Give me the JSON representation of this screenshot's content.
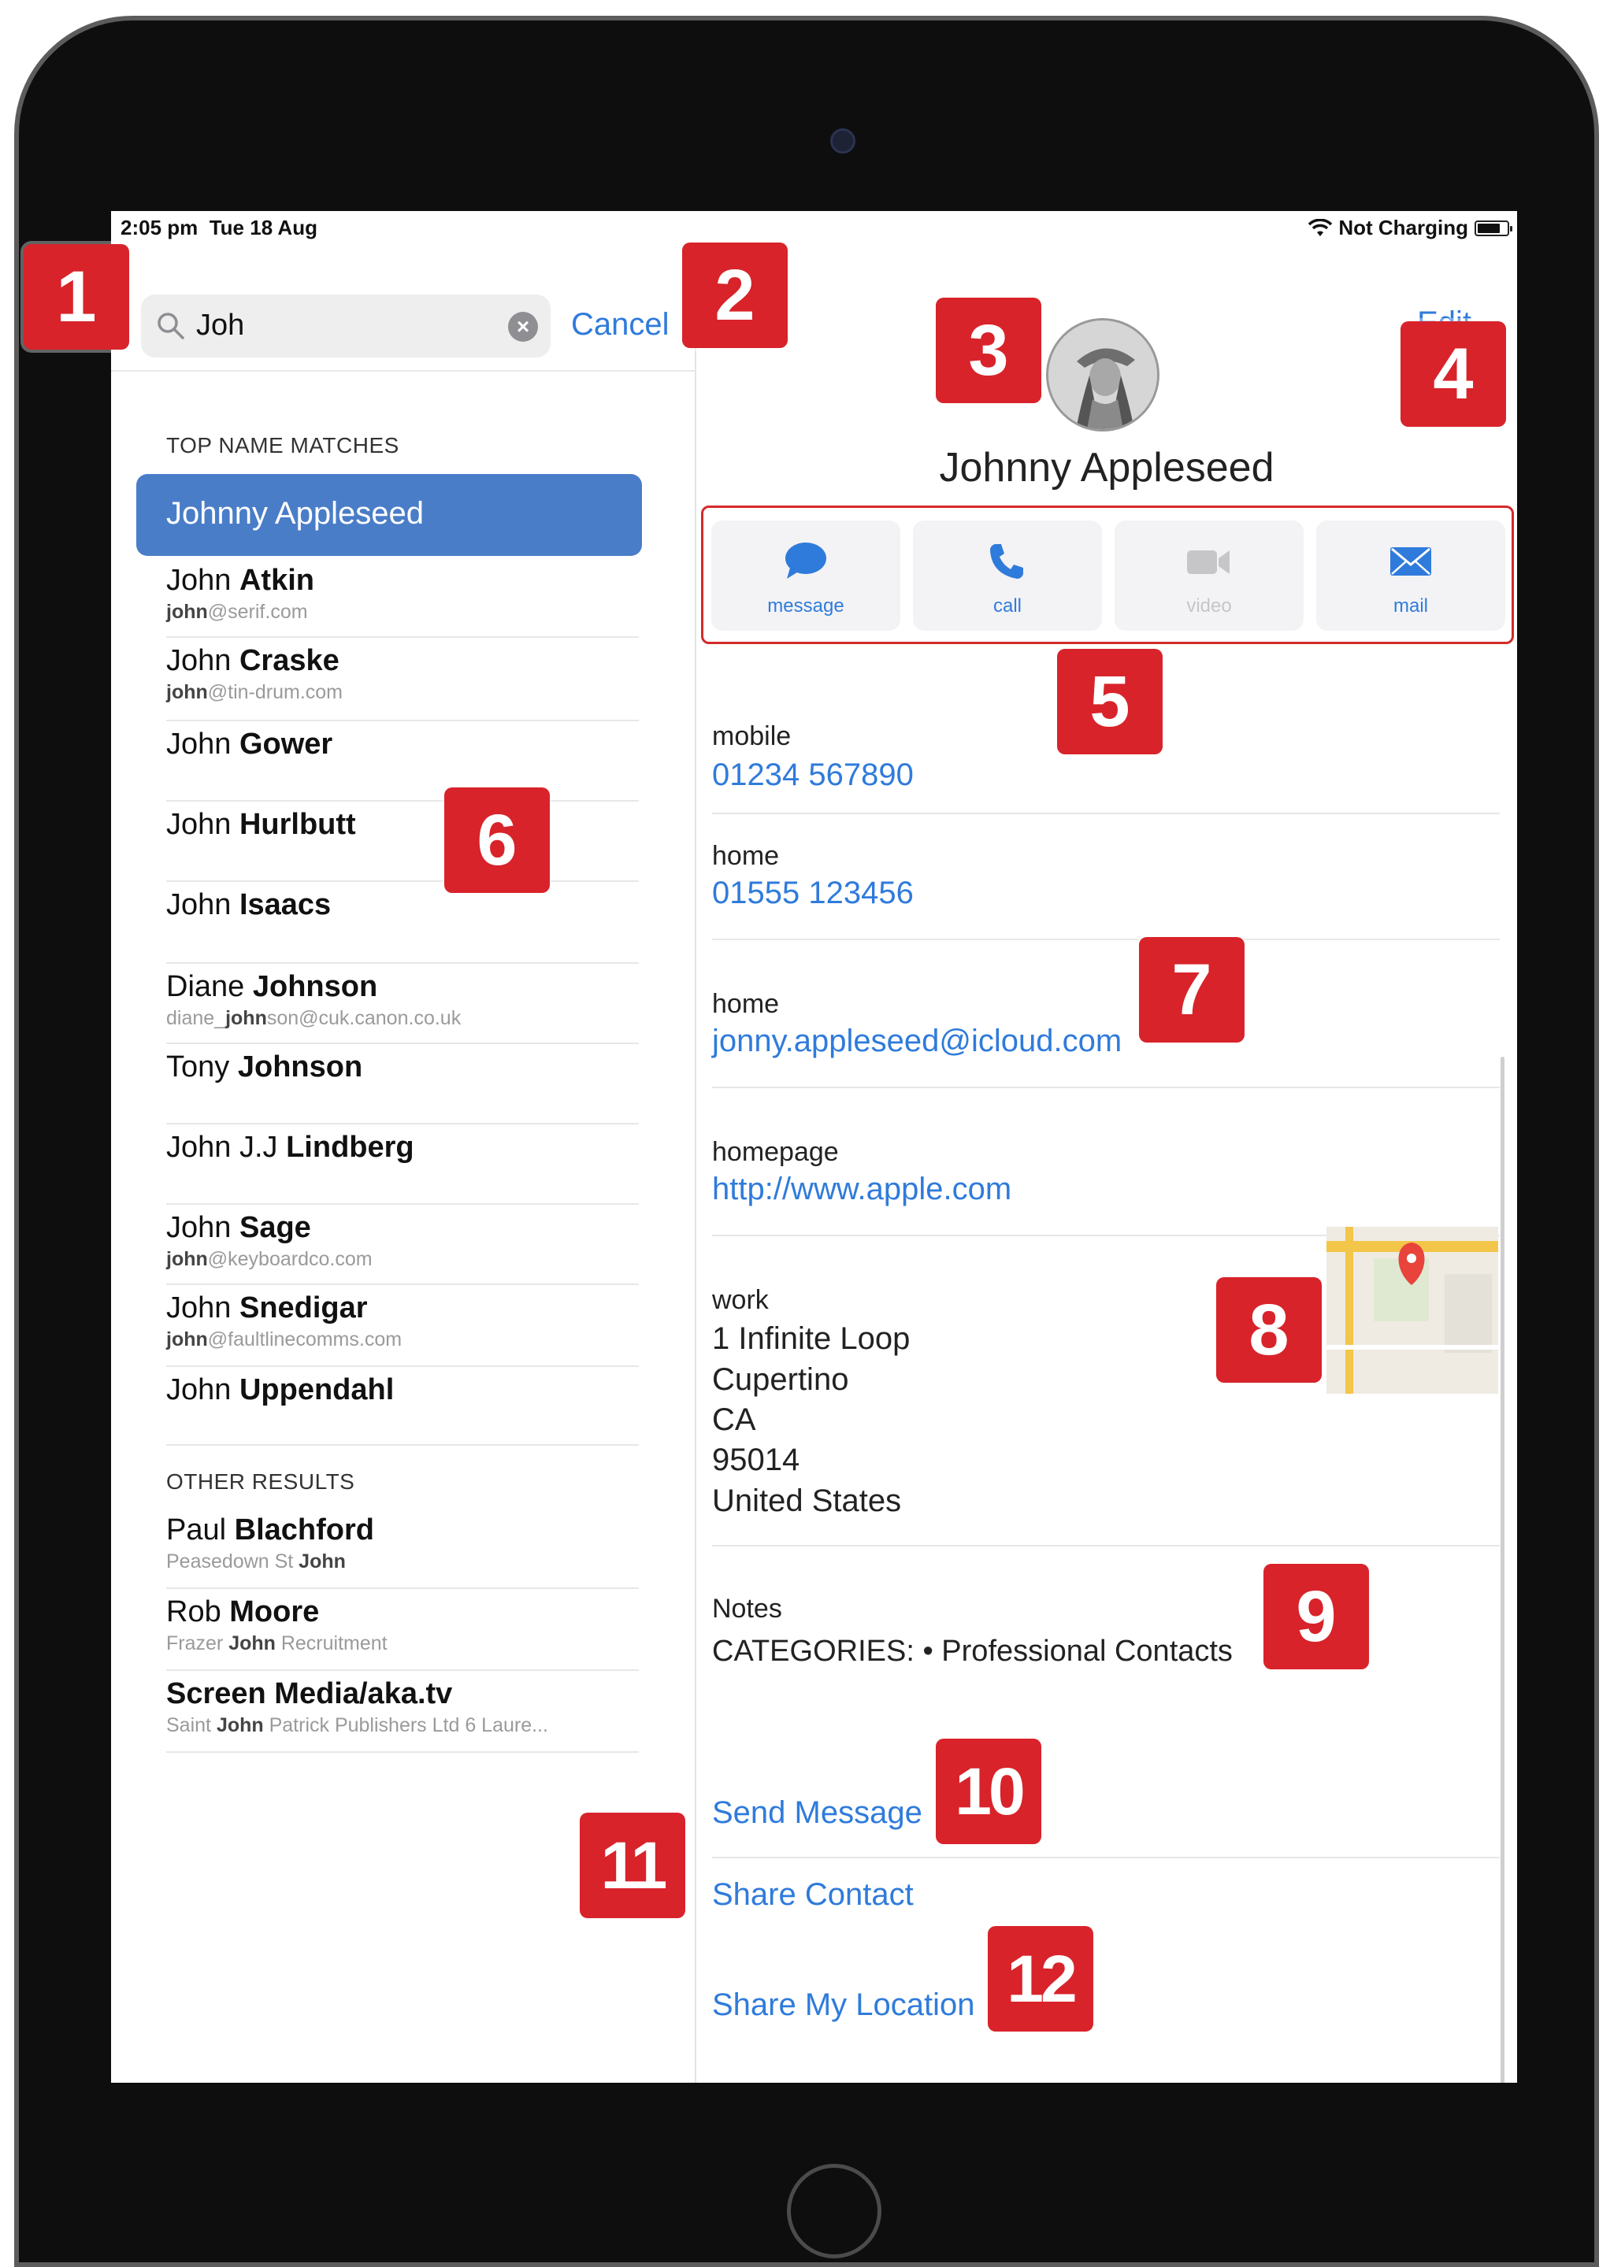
{
  "status_bar": {
    "time": "2:05 pm",
    "date": "Tue 18 Aug",
    "battery_text": "Not Charging"
  },
  "search": {
    "query": "Joh",
    "cancel_label": "Cancel"
  },
  "left": {
    "top_matches_label": "TOP NAME MATCHES",
    "selected": "Johnny Appleseed",
    "contacts": [
      {
        "first": "John",
        "last": "Atkin",
        "sub_pre": "",
        "sub_match": "john",
        "sub_post": "@serif.com"
      },
      {
        "first": "John",
        "last": "Craske",
        "sub_pre": "",
        "sub_match": "john",
        "sub_post": "@tin-drum.com"
      },
      {
        "first": "John",
        "last": "Gower"
      },
      {
        "first": "John",
        "last": "Hurlbutt"
      },
      {
        "first": "John",
        "last": "Isaacs"
      },
      {
        "first": "Diane",
        "last": "Johnson",
        "sub_pre": "diane_",
        "sub_match": "john",
        "sub_post": "son@cuk.canon.co.uk"
      },
      {
        "first": "Tony",
        "last": "Johnson"
      },
      {
        "first": "John J.J",
        "last": "Lindberg"
      },
      {
        "first": "John",
        "last": "Sage",
        "sub_pre": "",
        "sub_match": "john",
        "sub_post": "@keyboardco.com"
      },
      {
        "first": "John",
        "last": "Snedigar",
        "sub_pre": "",
        "sub_match": "john",
        "sub_post": "@faultlinecomms.com"
      },
      {
        "first": "John",
        "last": "Uppendahl"
      }
    ],
    "other_results_label": "OTHER RESULTS",
    "other": [
      {
        "first": "Paul",
        "last": "Blachford",
        "sub_pre": "Peasedown St ",
        "sub_match": "John",
        "sub_post": ""
      },
      {
        "first": "Rob",
        "last": "Moore",
        "sub_pre": "Frazer ",
        "sub_match": "John",
        "sub_post": " Recruitment"
      },
      {
        "first": "",
        "last": "Screen Media/aka.tv",
        "sub_pre": "Saint ",
        "sub_match": "John",
        "sub_post": " Patrick Publishers Ltd 6 Laure..."
      }
    ]
  },
  "right": {
    "edit_label": "Edit",
    "name": "Johnny Appleseed",
    "actions": [
      {
        "label": "message",
        "icon": "message-bubble-icon",
        "enabled": true
      },
      {
        "label": "call",
        "icon": "phone-icon",
        "enabled": true
      },
      {
        "label": "video",
        "icon": "video-camera-icon",
        "enabled": false
      },
      {
        "label": "mail",
        "icon": "envelope-icon",
        "enabled": true
      }
    ],
    "fields": {
      "mobile_label": "mobile",
      "mobile_value": "01234 567890",
      "home_phone_label": "home",
      "home_phone_value": "01555 123456",
      "home_email_label": "home",
      "home_email_value": "jonny.appleseed@icloud.com",
      "homepage_label": "homepage",
      "homepage_value": "http://www.apple.com",
      "work_label": "work",
      "address": [
        "1 Infinite Loop",
        "Cupertino",
        "CA",
        "95014",
        "United States"
      ],
      "notes_label": "Notes",
      "notes_value": "CATEGORIES: • Professional Contacts"
    },
    "links": [
      "Send Message",
      "Share Contact",
      "Share My Location"
    ]
  },
  "callouts": [
    "1",
    "2",
    "3",
    "4",
    "5",
    "6",
    "7",
    "8",
    "9",
    "10",
    "11",
    "12"
  ],
  "colors": {
    "accent": "#2f7bdb",
    "selected_row": "#4a7dc8",
    "callout": "#d8232a"
  }
}
